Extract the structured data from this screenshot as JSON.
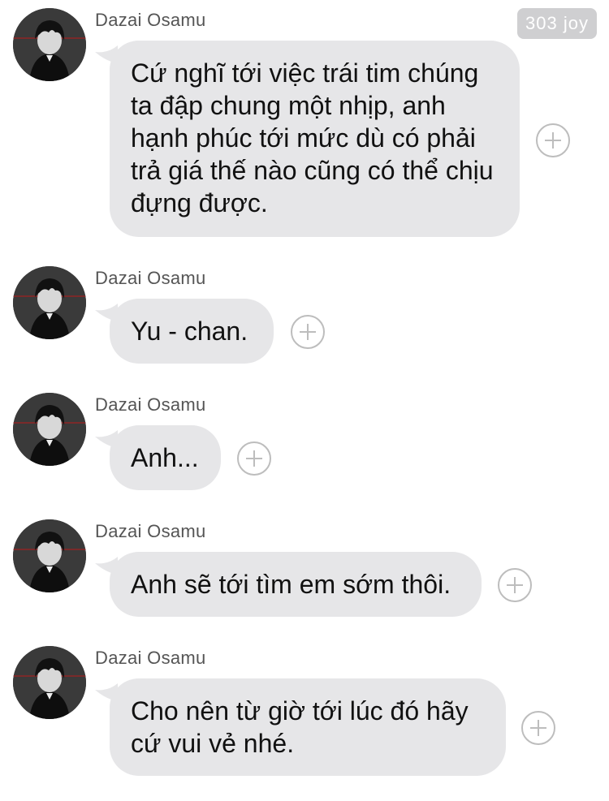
{
  "header": {
    "badge": "303 joy"
  },
  "messages": [
    {
      "sender": "Dazai Osamu",
      "text": "Cứ nghĩ tới việc trái tim chúng ta đập chung một nhịp, anh hạnh phúc tới mức dù có phải trả giá thế nào cũng có thể chịu đựng được.",
      "avatar_icon": "avatar-dazai-osamu"
    },
    {
      "sender": "Dazai Osamu",
      "text": "Yu - chan.",
      "avatar_icon": "avatar-dazai-osamu"
    },
    {
      "sender": "Dazai Osamu",
      "text": "Anh...",
      "avatar_icon": "avatar-dazai-osamu"
    },
    {
      "sender": "Dazai Osamu",
      "text": "Anh sẽ tới tìm em sớm thôi.",
      "avatar_icon": "avatar-dazai-osamu"
    },
    {
      "sender": "Dazai Osamu",
      "text": "Cho nên từ giờ tới lúc đó hãy cứ vui vẻ nhé.",
      "avatar_icon": "avatar-dazai-osamu"
    }
  ],
  "colors": {
    "bubble": "#e6e6e8",
    "badge": "#cfcfd1",
    "plus": "#bdbdbd"
  }
}
